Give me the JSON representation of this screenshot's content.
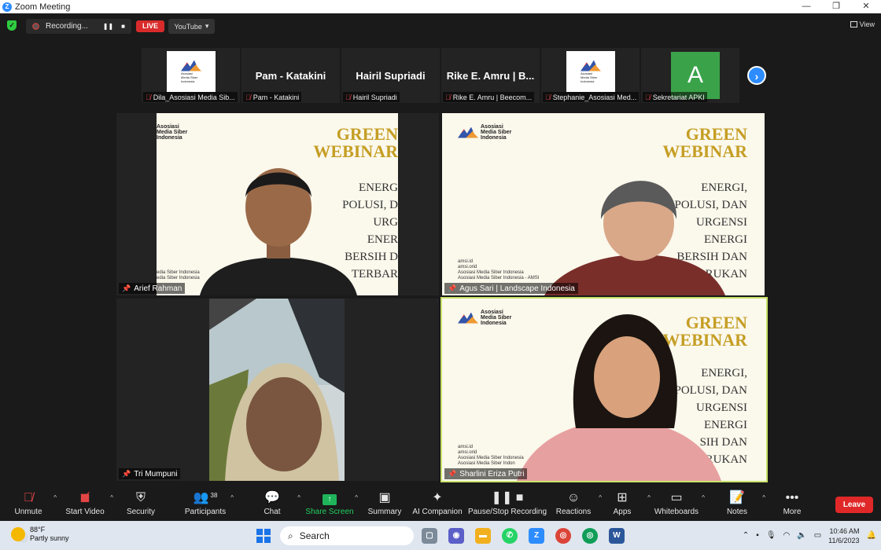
{
  "window": {
    "title": "Zoom Meeting",
    "controls": [
      "—",
      "❐",
      "✕"
    ]
  },
  "topbar": {
    "recording_label": "Recording...",
    "live_label": "LIVE",
    "stream_target": "YouTube",
    "view_label": "View"
  },
  "strip": [
    {
      "display": "",
      "label": "Dila_Asosiasi Media Sib...",
      "type": "logo"
    },
    {
      "display": "Pam - Katakini",
      "label": "Pam - Katakini",
      "type": "name"
    },
    {
      "display": "Hairil Supriadi",
      "label": "Hairil Supriadi",
      "type": "name"
    },
    {
      "display": "Rike E. Amru | B...",
      "label": "Rike E. Amru | Beecom...",
      "type": "name"
    },
    {
      "display": "",
      "label": "Stephanie_Asosiasi Med...",
      "type": "logo"
    },
    {
      "display": "A",
      "label": "Sekretariat APKI",
      "type": "avatar"
    }
  ],
  "logo_text": {
    "line1": "Asosiasi",
    "line2": "Media Siber",
    "line3": "Indonesia"
  },
  "slide": {
    "green": "GREEN",
    "webinar": "WEBINAR",
    "topics_full": [
      "ENERGI,",
      "POLUSI, DAN",
      "URGENSI",
      "ENERGI",
      "BERSIH DAN",
      "TERBARUKAN"
    ],
    "topics_left": [
      "ENERG",
      "POLUSI, D",
      "URG",
      "ENER",
      "BERSIH D",
      "TERBAR"
    ],
    "topics_bottom": [
      "ENERGI,",
      "POLUSI, DAN",
      "URGENSI",
      "ENERGI",
      "SIH DAN",
      "RUKAN"
    ],
    "contacts": [
      "amsi.id",
      "amsi.orid",
      "Asosiasi Media Siber Indonesia",
      "Asosiasi Media Siber Indonesia - AMSI"
    ],
    "contacts_left": [
      "edia Siber Indonesia",
      "edia Siber Indonesia"
    ],
    "contacts_bottom": [
      "amsi.id",
      "amsi.orid",
      "Asosiasi Media Siber Indonesia",
      "Asosiasi Media Siber Indon"
    ]
  },
  "tiles": [
    {
      "name": "Arief Rahman"
    },
    {
      "name": "Agus Sari | Landscape Indonesia"
    },
    {
      "name": "Tri Mumpuni"
    },
    {
      "name": "Sharlini Eriza Putri"
    }
  ],
  "toolbar": {
    "unmute": "Unmute",
    "start_video": "Start Video",
    "security": "Security",
    "participants": "Participants",
    "participants_count": "38",
    "chat": "Chat",
    "share_screen": "Share Screen",
    "summary": "Summary",
    "ai_companion": "AI Companion",
    "pause_stop_recording": "Pause/Stop Recording",
    "reactions": "Reactions",
    "apps": "Apps",
    "whiteboards": "Whiteboards",
    "notes": "Notes",
    "more": "More",
    "leave": "Leave"
  },
  "taskbar": {
    "temperature": "88°F",
    "weather": "Partly sunny",
    "search_placeholder": "Search",
    "time": "10:46 AM",
    "date": "11/6/2023"
  },
  "colors": {
    "accent": "#2d8cff",
    "live": "#d92b2b",
    "leave": "#e02828",
    "share": "#1fb45a",
    "slide_gold": "#c59e24",
    "active_speaker": "#c8e26a"
  }
}
